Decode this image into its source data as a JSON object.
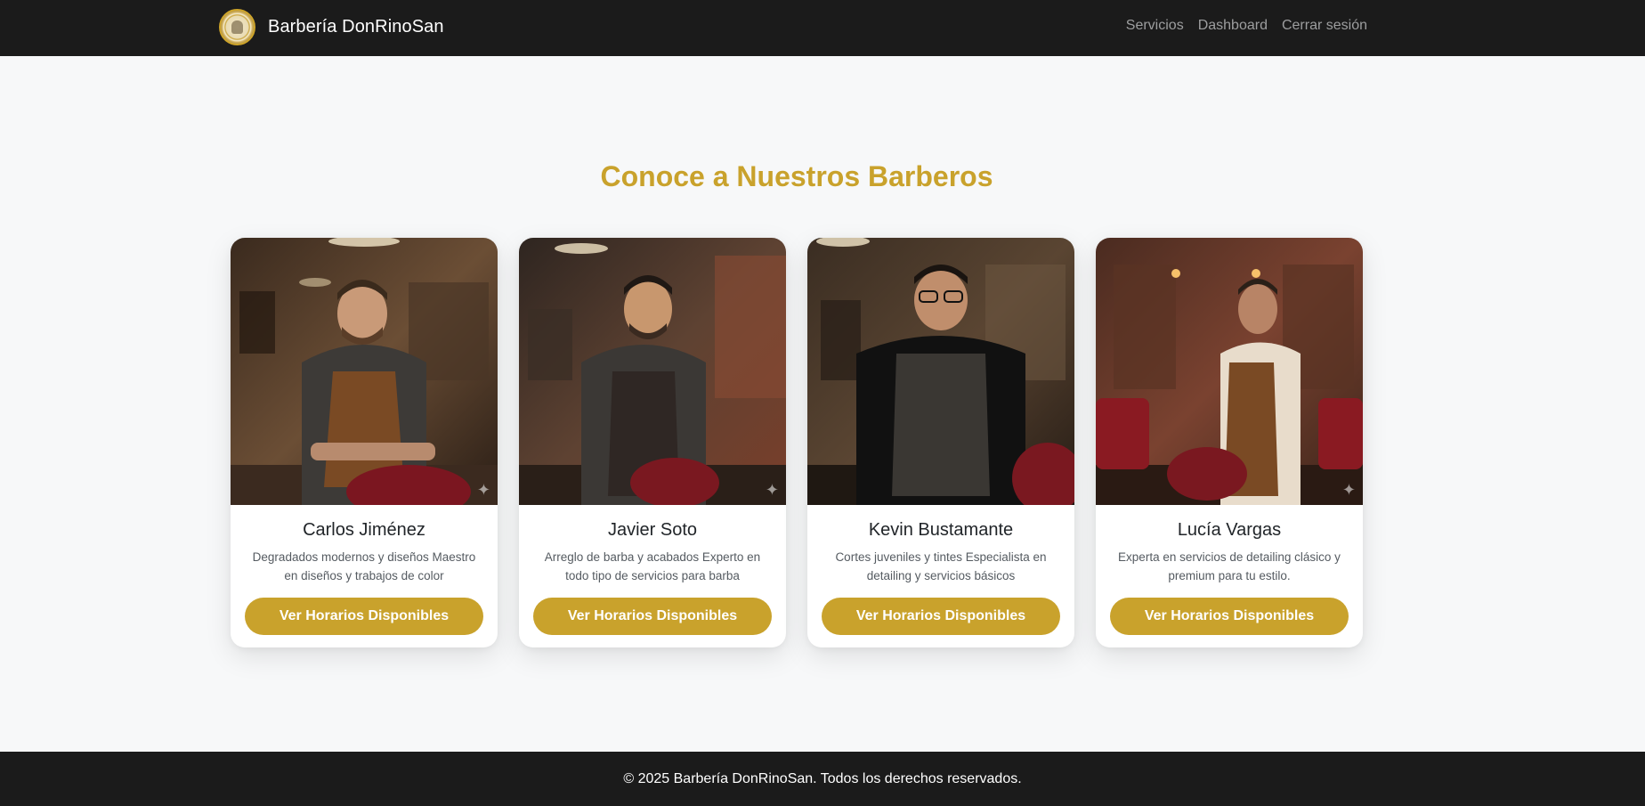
{
  "navbar": {
    "brand_name": "Barbería DonRinoSan",
    "links": [
      {
        "label": "Servicios"
      },
      {
        "label": "Dashboard"
      },
      {
        "label": "Cerrar sesión"
      }
    ]
  },
  "main": {
    "heading": "Conoce a Nuestros Barberos",
    "barbers": [
      {
        "name": "Carlos Jiménez",
        "description": "Degradados modernos y diseños Maestro en diseños y trabajos de color",
        "button_label": "Ver Horarios Disponibles"
      },
      {
        "name": "Javier Soto",
        "description": "Arreglo de barba y acabados Experto en todo tipo de servicios para barba",
        "button_label": "Ver Horarios Disponibles"
      },
      {
        "name": "Kevin Bustamante",
        "description": "Cortes juveniles y tintes Especialista en detailing y servicios básicos",
        "button_label": "Ver Horarios Disponibles"
      },
      {
        "name": "Lucía Vargas",
        "description": "Experta en servicios de detailing clásico y premium para tu estilo.",
        "button_label": "Ver Horarios Disponibles"
      }
    ]
  },
  "footer": {
    "text": "© 2025 Barbería DonRinoSan. Todos los derechos reservados."
  },
  "colors": {
    "accent": "#c9a22c",
    "nav_bg": "#1b1b1b",
    "page_bg": "#f7f8f9"
  },
  "icons": {
    "logo": "barbershop-logo",
    "sparkle": "sparkle-icon"
  }
}
